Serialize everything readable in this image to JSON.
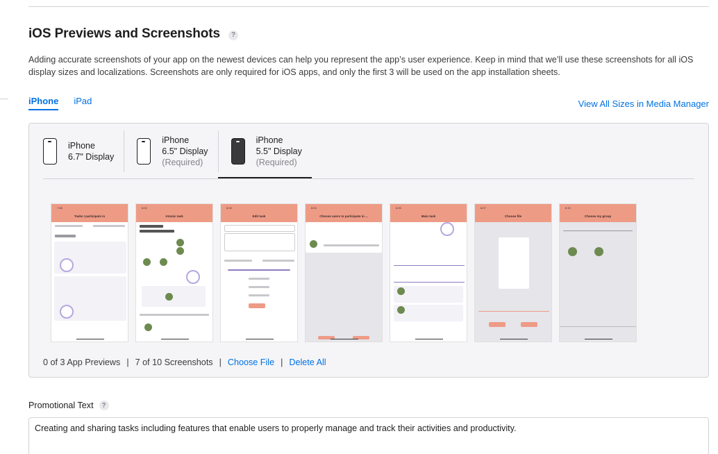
{
  "section": {
    "title": "iOS Previews and Screenshots",
    "help": "?",
    "description": "Adding accurate screenshots of your app on the newest devices can help you represent the app’s user experience. Keep in mind that we’ll use these screenshots for all iOS display sizes and localizations. Screenshots are only required for iOS apps, and only the first 3 will be used on the app installation sheets."
  },
  "tabs": [
    {
      "label": "iPhone",
      "active": true
    },
    {
      "label": "iPad",
      "active": false
    }
  ],
  "media_manager_link": "View All Sizes in Media Manager",
  "devices": [
    {
      "name": "iPhone",
      "size": "6.7\" Display",
      "required": "",
      "icon": "iphone-outline-icon"
    },
    {
      "name": "iPhone",
      "size": "6.5\" Display",
      "required": "(Required)",
      "icon": "iphone-outline-icon"
    },
    {
      "name": "iPhone",
      "size": "5.5\" Display",
      "required": "(Required)",
      "icon": "iphone-filled-icon",
      "selected": true
    }
  ],
  "screenshots": [
    {
      "title": "Tasks I participate in",
      "time": "7:58"
    },
    {
      "title": "Atomic task",
      "time": "8:02"
    },
    {
      "title": "Edit task",
      "time": "8:03"
    },
    {
      "title": "Choose users to participate in ...",
      "time": "8:04"
    },
    {
      "title": "Main task",
      "time": "8:09"
    },
    {
      "title": "Choose file",
      "time": "8:07"
    },
    {
      "title": "Choose my group",
      "time": "8:10"
    }
  ],
  "footer": {
    "previews": "0 of 3 App Previews",
    "screenshots": "7 of 10 Screenshots",
    "choose_file": "Choose File",
    "delete_all": "Delete All",
    "separator": "|"
  },
  "promo": {
    "label": "Promotional Text",
    "help": "?",
    "value": "Creating and sharing tasks including features that enable users to properly manage and track their activities and productivity."
  },
  "colors": {
    "accent": "#0071e3",
    "app_header": "#ee9b86",
    "panel_bg": "#f5f5f7"
  }
}
